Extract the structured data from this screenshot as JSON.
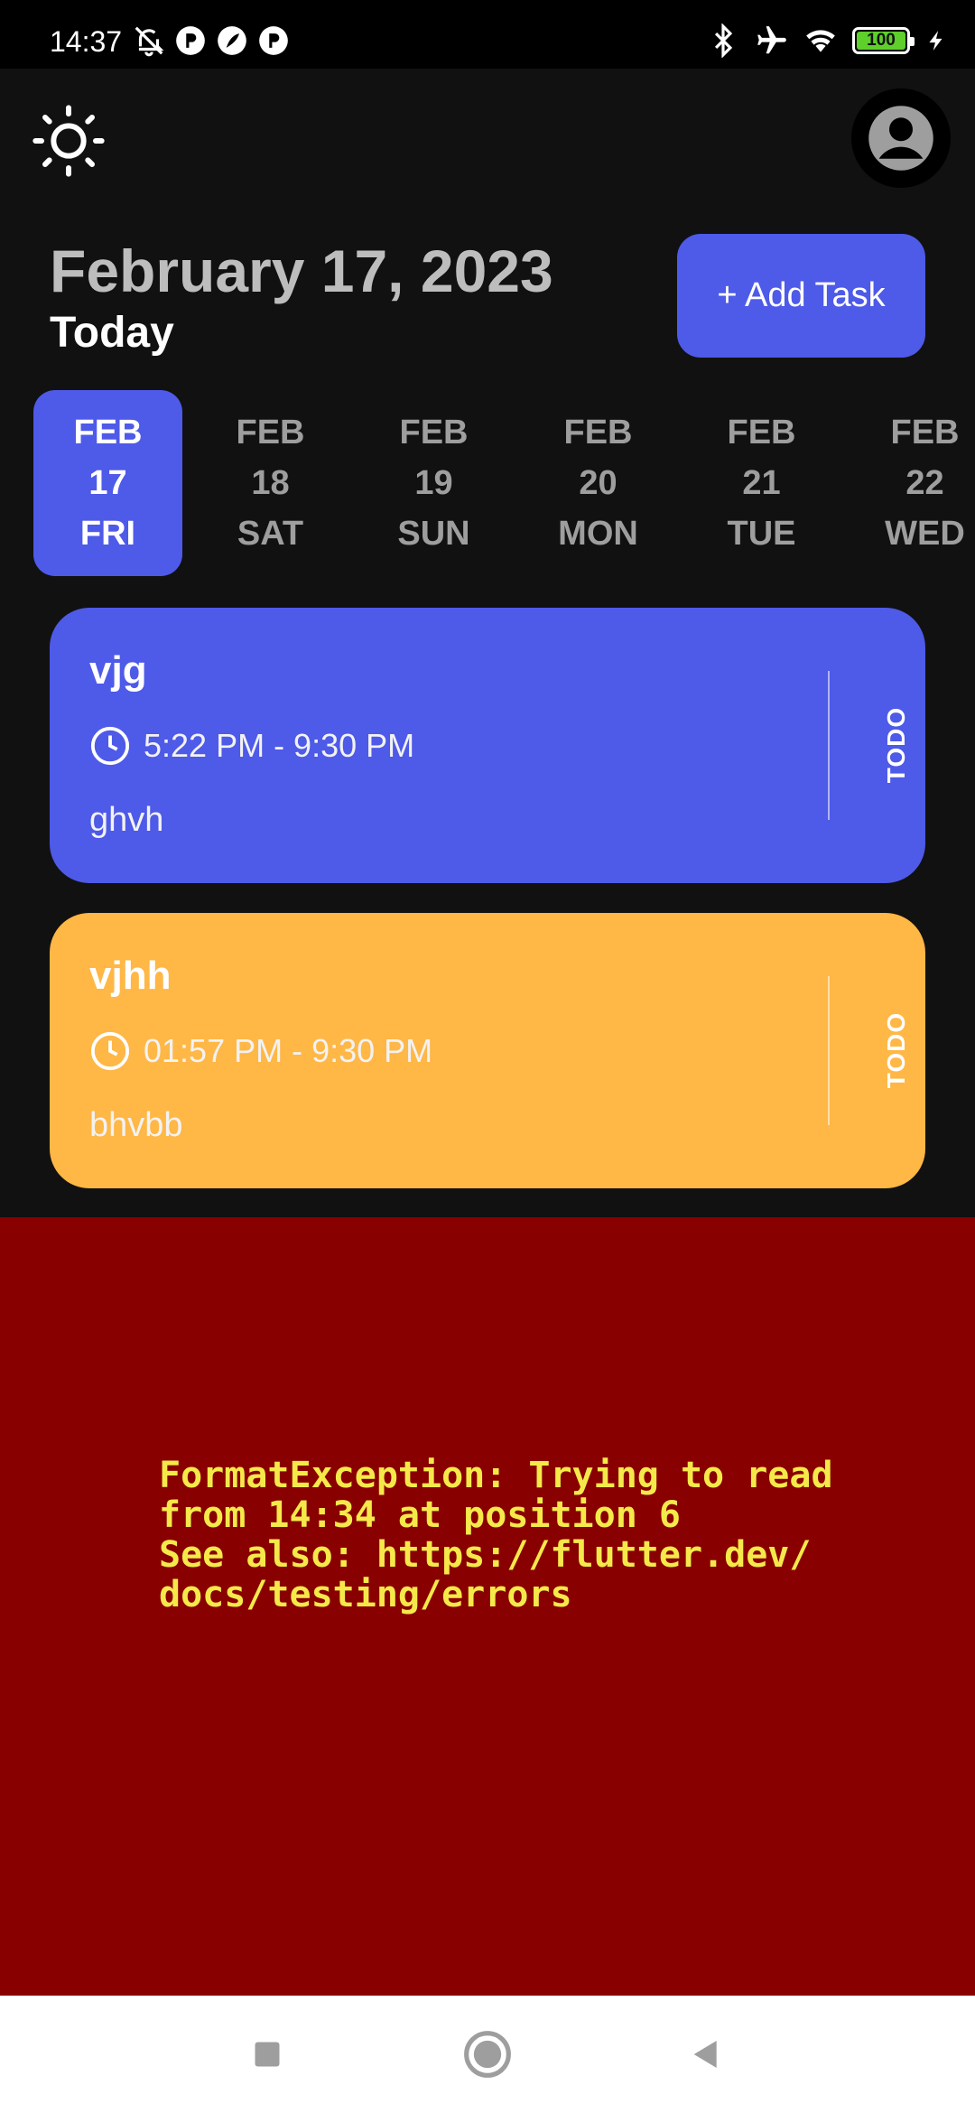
{
  "status_bar": {
    "time": "14:37",
    "battery_level": "100",
    "icons": [
      "mute-bell-icon",
      "app-notification-icon",
      "feather-icon",
      "app-notification-icon",
      "bluetooth-icon",
      "airplane-icon",
      "wifi-icon",
      "battery-icon",
      "charging-icon"
    ]
  },
  "header": {
    "theme_icon": "sun-icon",
    "avatar_icon": "user-icon",
    "date_title": "February 17, 2023",
    "today_label": "Today",
    "add_task_label": "+ Add Task"
  },
  "date_strip": {
    "items": [
      {
        "month": "FEB",
        "day": "17",
        "weekday": "FRI",
        "selected": true
      },
      {
        "month": "FEB",
        "day": "18",
        "weekday": "SAT",
        "selected": false
      },
      {
        "month": "FEB",
        "day": "19",
        "weekday": "SUN",
        "selected": false
      },
      {
        "month": "FEB",
        "day": "20",
        "weekday": "MON",
        "selected": false
      },
      {
        "month": "FEB",
        "day": "21",
        "weekday": "TUE",
        "selected": false
      },
      {
        "month": "FEB",
        "day": "22",
        "weekday": "WED",
        "selected": false
      }
    ]
  },
  "tasks": [
    {
      "title": "vjg",
      "time": "5:22 PM - 9:30 PM",
      "note": "ghvh",
      "status": "TODO",
      "color": "#4e5ae8"
    },
    {
      "title": "vjhh",
      "time": "01:57 PM - 9:30 PM",
      "note": "bhvbb",
      "status": "TODO",
      "color": "#ffb746"
    }
  ],
  "error": {
    "lines": [
      "FormatException: Trying to read",
      "from 14:34 at position 6",
      "See also: https://flutter.dev/",
      "docs/testing/errors"
    ],
    "background": "#890000",
    "text_color": "#f5e94a"
  },
  "nav_bar": {
    "icons": [
      "recent-apps-icon",
      "home-icon",
      "back-icon"
    ]
  },
  "colors": {
    "accent": "#4e5ae8",
    "orange": "#ffb746",
    "background": "#111111"
  }
}
